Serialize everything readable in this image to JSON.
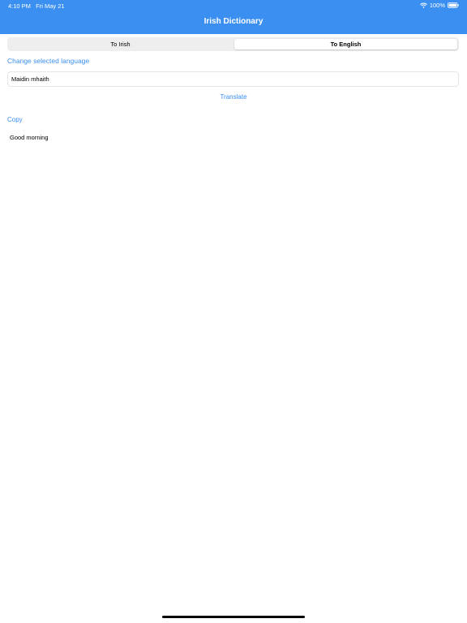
{
  "status_bar": {
    "time_date": "4:10 PM   Fri May 21",
    "battery": "100%"
  },
  "nav": {
    "title": "Irish Dictionary"
  },
  "segmented": {
    "options": [
      "To Irish",
      "To English"
    ],
    "selected": "To English"
  },
  "change_language": "Change selected language",
  "input": {
    "value": "Maidin mhaith"
  },
  "translate_label": "Translate",
  "copy_label": "Copy",
  "result": "Good morning",
  "colors": {
    "accent": "#3a8ff0",
    "background": "#ffffff"
  },
  "icons": [
    "wifi-icon",
    "battery-icon"
  ]
}
